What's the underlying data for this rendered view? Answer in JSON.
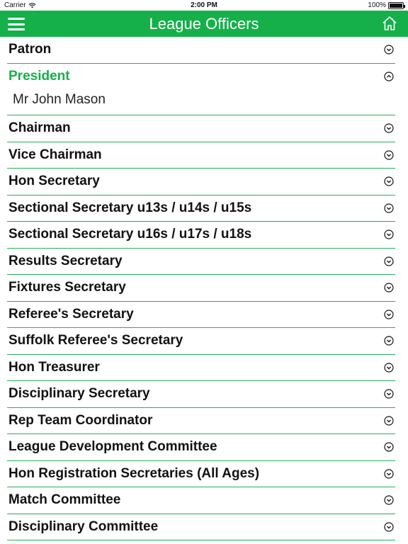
{
  "status": {
    "carrier": "Carrier",
    "time": "2:00 PM",
    "battery": "100%",
    "battery_level": 1.0
  },
  "nav": {
    "title": "League Officers",
    "menu_icon": "hamburger-icon",
    "home_icon": "home-icon"
  },
  "colors": {
    "accent": "#15b04a",
    "divider": "#22b25a"
  },
  "sections": [
    {
      "title": "Patron",
      "open": false
    },
    {
      "title": "President",
      "open": true,
      "content": "Mr John Mason"
    },
    {
      "title": "Chairman",
      "open": false
    },
    {
      "title": "Vice Chairman",
      "open": false
    },
    {
      "title": "Hon Secretary",
      "open": false
    },
    {
      "title": "Sectional Secretary u13s / u14s / u15s",
      "open": false
    },
    {
      "title": "Sectional Secretary u16s / u17s / u18s",
      "open": false
    },
    {
      "title": "Results Secretary",
      "open": false
    },
    {
      "title": "Fixtures Secretary",
      "open": false
    },
    {
      "title": "Referee's Secretary",
      "open": false
    },
    {
      "title": "Suffolk Referee's Secretary",
      "open": false
    },
    {
      "title": "Hon Treasurer",
      "open": false
    },
    {
      "title": "Disciplinary Secretary",
      "open": false
    },
    {
      "title": "Rep Team Coordinator",
      "open": false
    },
    {
      "title": "League Development Committee",
      "open": false
    },
    {
      "title": "Hon Registration Secretaries (All Ages)",
      "open": false
    },
    {
      "title": "Match Committee",
      "open": false
    },
    {
      "title": "Disciplinary Committee",
      "open": false
    }
  ]
}
